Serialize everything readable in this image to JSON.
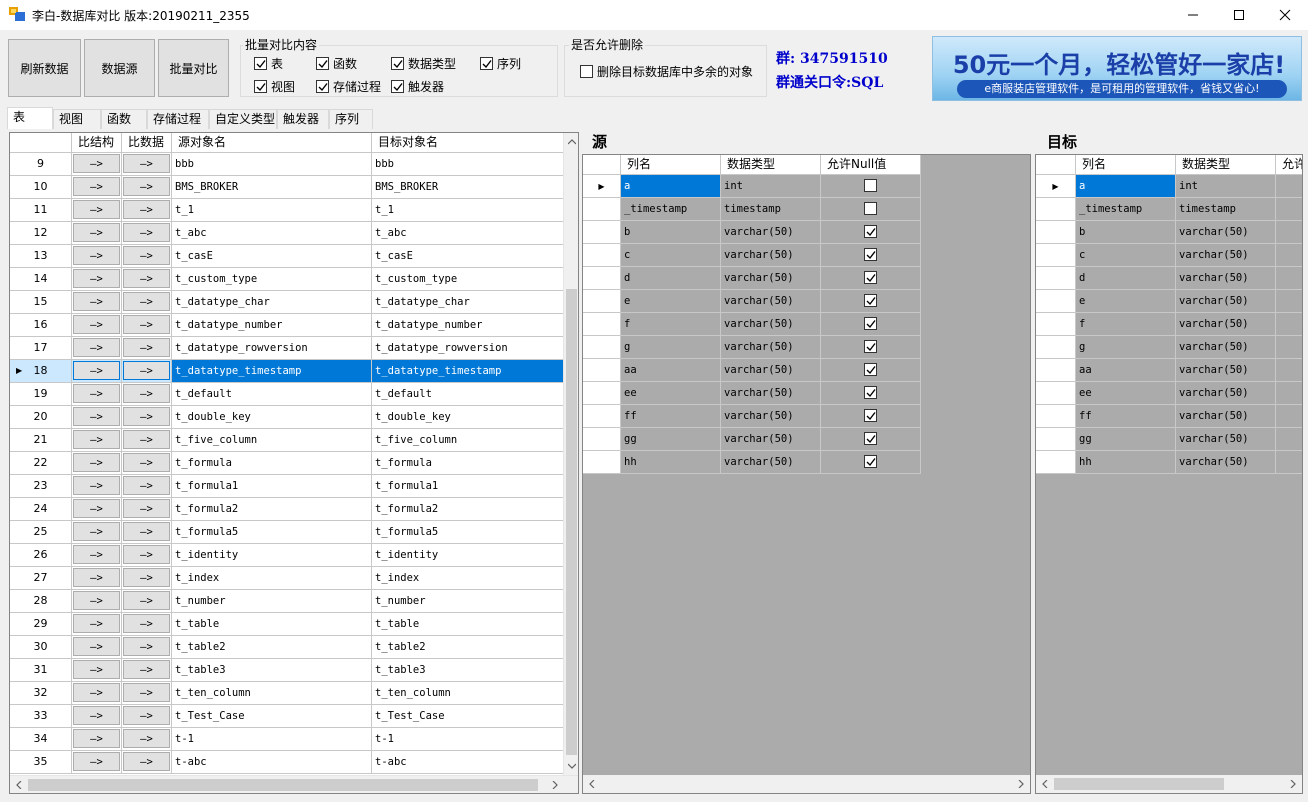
{
  "window": {
    "title": "李白-数据库对比 版本:20190211_2355"
  },
  "toolbar": {
    "refresh": "刷新数据",
    "datasource": "数据源",
    "batch_compare": "批量对比"
  },
  "batch_group": {
    "title": "批量对比内容",
    "items": [
      {
        "label": "表",
        "checked": true
      },
      {
        "label": "函数",
        "checked": true
      },
      {
        "label": "数据类型",
        "checked": true
      },
      {
        "label": "序列",
        "checked": true
      },
      {
        "label": "视图",
        "checked": true
      },
      {
        "label": "存储过程",
        "checked": true
      },
      {
        "label": "触发器",
        "checked": true
      }
    ]
  },
  "delete_group": {
    "title": "是否允许删除",
    "option": {
      "label": "删除目标数据库中多余的对象",
      "checked": false
    }
  },
  "contact": {
    "qq_group": "群: 347591510",
    "password": "群通关口令:SQL"
  },
  "banner": {
    "main": "50元一个月，轻松管好一家店!",
    "sub": "e商服装店管理软件，是可租用的管理软件，省钱又省心!"
  },
  "tabs": [
    "表",
    "视图",
    "函数",
    "存储过程",
    "自定义类型",
    "触发器",
    "序列"
  ],
  "object_grid": {
    "headers": [
      "比结构",
      "比数据",
      "源对象名",
      "目标对象名"
    ],
    "arrow": "—>",
    "selected_row": 18,
    "rows": [
      {
        "n": "9",
        "src": "bbb",
        "dst": "bbb"
      },
      {
        "n": "10",
        "src": "BMS_BROKER",
        "dst": "BMS_BROKER"
      },
      {
        "n": "11",
        "src": "t_1",
        "dst": "t_1"
      },
      {
        "n": "12",
        "src": "t_abc",
        "dst": "t_abc"
      },
      {
        "n": "13",
        "src": "t_casE",
        "dst": "t_casE"
      },
      {
        "n": "14",
        "src": "t_custom_type",
        "dst": "t_custom_type"
      },
      {
        "n": "15",
        "src": "t_datatype_char",
        "dst": "t_datatype_char"
      },
      {
        "n": "16",
        "src": "t_datatype_number",
        "dst": "t_datatype_number"
      },
      {
        "n": "17",
        "src": "t_datatype_rowversion",
        "dst": "t_datatype_rowversion"
      },
      {
        "n": "18",
        "src": "t_datatype_timestamp",
        "dst": "t_datatype_timestamp"
      },
      {
        "n": "19",
        "src": "t_default",
        "dst": "t_default"
      },
      {
        "n": "20",
        "src": "t_double_key",
        "dst": "t_double_key"
      },
      {
        "n": "21",
        "src": "t_five_column",
        "dst": "t_five_column"
      },
      {
        "n": "22",
        "src": "t_formula",
        "dst": "t_formula"
      },
      {
        "n": "23",
        "src": "t_formula1",
        "dst": "t_formula1"
      },
      {
        "n": "24",
        "src": "t_formula2",
        "dst": "t_formula2"
      },
      {
        "n": "25",
        "src": "t_formula5",
        "dst": "t_formula5"
      },
      {
        "n": "26",
        "src": "t_identity",
        "dst": "t_identity"
      },
      {
        "n": "27",
        "src": "t_index",
        "dst": "t_index"
      },
      {
        "n": "28",
        "src": "t_number",
        "dst": "t_number"
      },
      {
        "n": "29",
        "src": "t_table",
        "dst": "t_table"
      },
      {
        "n": "30",
        "src": "t_table2",
        "dst": "t_table2"
      },
      {
        "n": "31",
        "src": "t_table3",
        "dst": "t_table3"
      },
      {
        "n": "32",
        "src": "t_ten_column",
        "dst": "t_ten_column"
      },
      {
        "n": "33",
        "src": "t_Test_Case",
        "dst": "t_Test_Case"
      },
      {
        "n": "34",
        "src": "t-1",
        "dst": "t-1"
      },
      {
        "n": "35",
        "src": "t-abc",
        "dst": "t-abc"
      }
    ]
  },
  "source_panel": {
    "title": "源",
    "headers": [
      "列名",
      "数据类型",
      "允许Null值"
    ],
    "rows": [
      {
        "name": "a",
        "type": "int",
        "nullable": false
      },
      {
        "name": "_timestamp",
        "type": "timestamp",
        "nullable": false
      },
      {
        "name": "b",
        "type": "varchar(50)",
        "nullable": true
      },
      {
        "name": "c",
        "type": "varchar(50)",
        "nullable": true
      },
      {
        "name": "d",
        "type": "varchar(50)",
        "nullable": true
      },
      {
        "name": "e",
        "type": "varchar(50)",
        "nullable": true
      },
      {
        "name": "f",
        "type": "varchar(50)",
        "nullable": true
      },
      {
        "name": "g",
        "type": "varchar(50)",
        "nullable": true
      },
      {
        "name": "aa",
        "type": "varchar(50)",
        "nullable": true
      },
      {
        "name": "ee",
        "type": "varchar(50)",
        "nullable": true
      },
      {
        "name": "ff",
        "type": "varchar(50)",
        "nullable": true
      },
      {
        "name": "gg",
        "type": "varchar(50)",
        "nullable": true
      },
      {
        "name": "hh",
        "type": "varchar(50)",
        "nullable": true
      }
    ]
  },
  "target_panel": {
    "title": "目标",
    "headers": [
      "列名",
      "数据类型",
      "允许"
    ],
    "rows": [
      {
        "name": "a",
        "type": "int"
      },
      {
        "name": "_timestamp",
        "type": "timestamp"
      },
      {
        "name": "b",
        "type": "varchar(50)"
      },
      {
        "name": "c",
        "type": "varchar(50)"
      },
      {
        "name": "d",
        "type": "varchar(50)"
      },
      {
        "name": "e",
        "type": "varchar(50)"
      },
      {
        "name": "f",
        "type": "varchar(50)"
      },
      {
        "name": "g",
        "type": "varchar(50)"
      },
      {
        "name": "aa",
        "type": "varchar(50)"
      },
      {
        "name": "ee",
        "type": "varchar(50)"
      },
      {
        "name": "ff",
        "type": "varchar(50)"
      },
      {
        "name": "gg",
        "type": "varchar(50)"
      },
      {
        "name": "hh",
        "type": "varchar(50)"
      }
    ]
  },
  "colors": {
    "selection": "#0078d7",
    "link_text": "#0000cc",
    "empty_area": "#ababab"
  }
}
